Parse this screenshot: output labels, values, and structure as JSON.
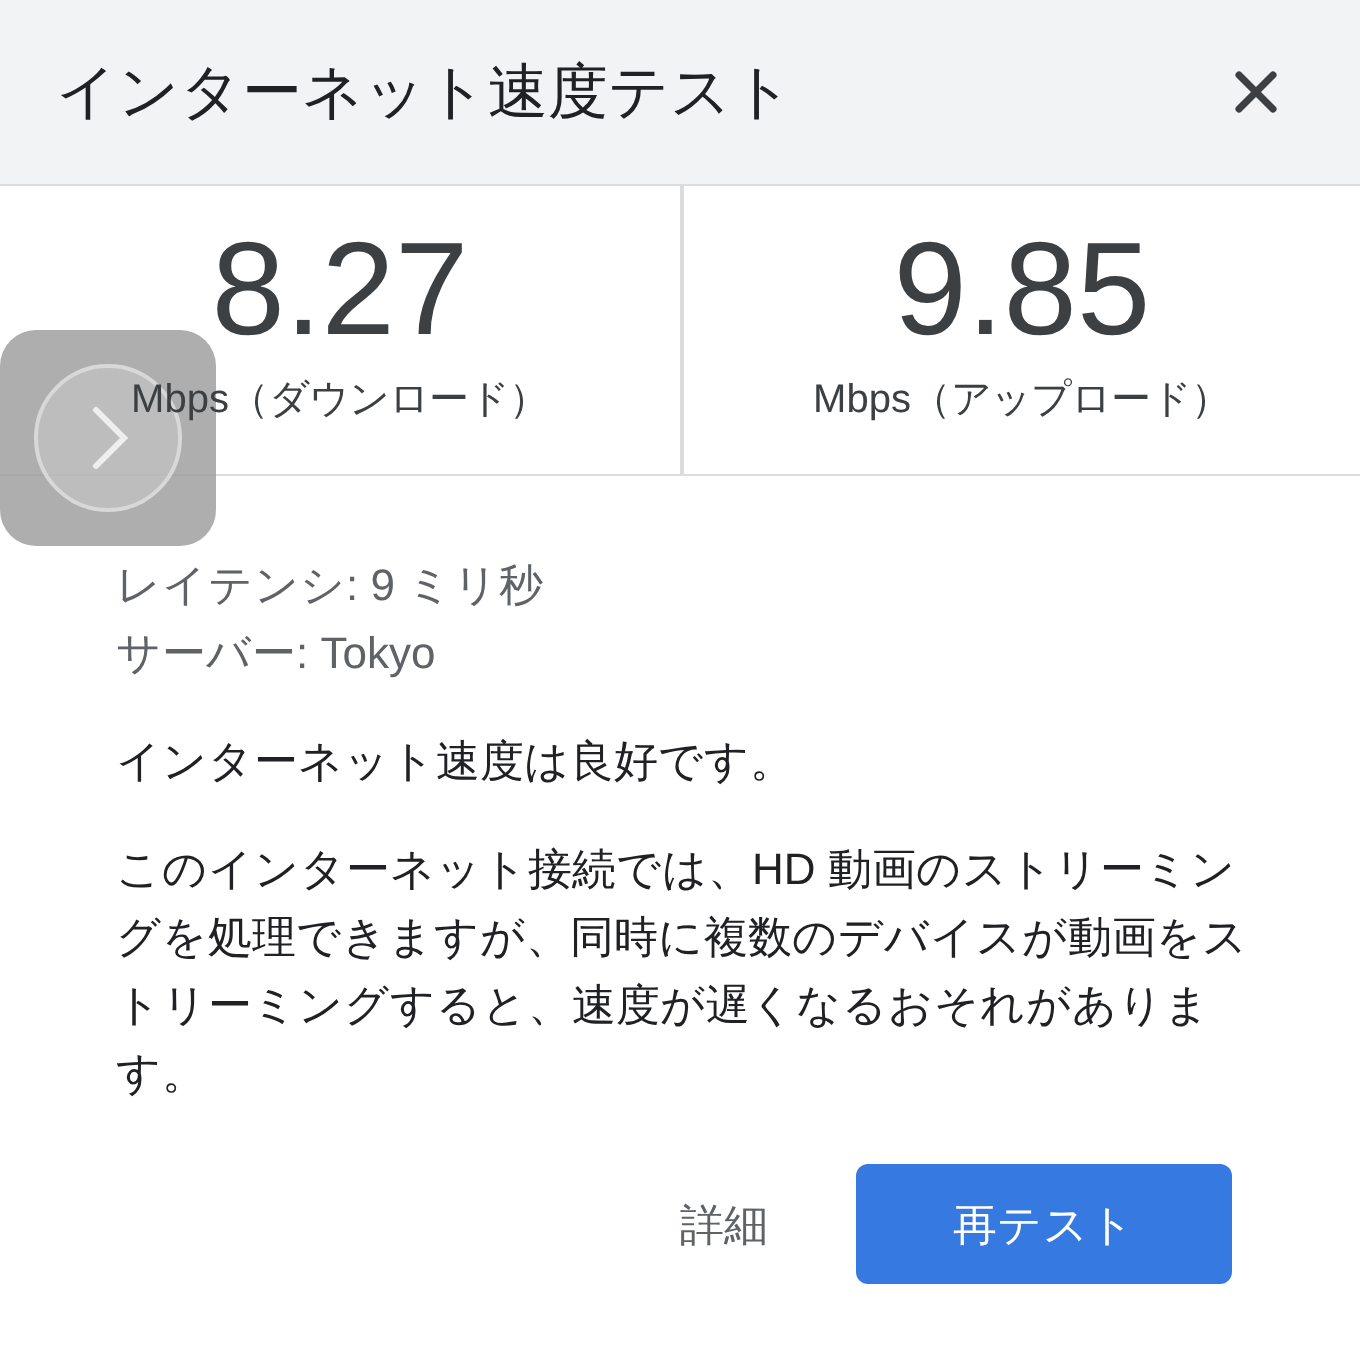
{
  "header": {
    "title": "インターネット速度テスト"
  },
  "results": [
    {
      "value": "8.27",
      "label": "Mbps（ダウンロード）"
    },
    {
      "value": "9.85",
      "label": "Mbps（アップロード）"
    }
  ],
  "details": [
    "レイテンシ: 9 ミリ秒",
    "サーバー: Tokyo"
  ],
  "summary": "インターネット速度は良好です。",
  "description": "このインターネット接続では、HD 動画のストリーミングを処理できますが、同時に複数のデバイスが動画をストリーミングすると、速度が遅くなるおそれがあります。",
  "buttons": [
    {
      "label": "詳細",
      "kind": "text"
    },
    {
      "label": "再テスト",
      "kind": "primary"
    }
  ]
}
